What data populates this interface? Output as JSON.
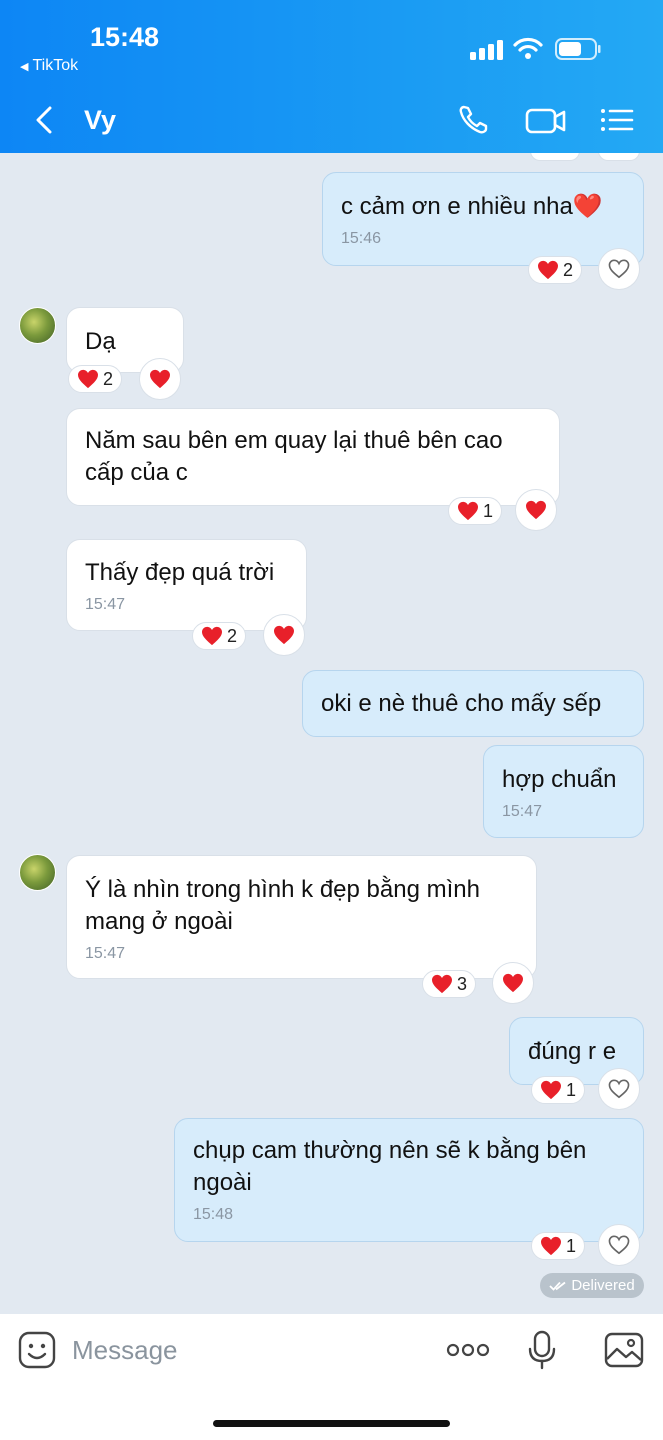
{
  "status_bar": {
    "time": "15:48",
    "back_app": "TikTok"
  },
  "header": {
    "contact_name": "Vy"
  },
  "messages": [
    {
      "text": "c cảm ơn e nhiều nha❤️",
      "time": "15:46",
      "reactions": "2"
    },
    {
      "text": "Dạ",
      "reactions": "2"
    },
    {
      "text": "Năm sau bên em quay lại thuê bên cao cấp của c",
      "reactions": "1"
    },
    {
      "text": "Thấy đẹp quá trời",
      "time": "15:47",
      "reactions": "2"
    },
    {
      "text": "oki e nè thuê cho mấy sếp"
    },
    {
      "text": "hợp chuẩn",
      "time": "15:47"
    },
    {
      "text": "Ý là nhìn trong hình k đẹp bằng mình mang ở ngoài",
      "time": "15:47",
      "reactions": "3"
    },
    {
      "text": "đúng r e",
      "reactions": "1"
    },
    {
      "text": "chụp cam thường nên sẽ k bằng bên ngoài",
      "time": "15:48",
      "reactions": "1"
    }
  ],
  "status": {
    "delivered": "Delivered"
  },
  "input": {
    "placeholder": "Message"
  },
  "colors": {
    "header_blue": "#0d86f5",
    "heart_red": "#e8202a",
    "chat_bg": "#e2e9f1",
    "outgoing_bubble": "#d7ecfb"
  }
}
